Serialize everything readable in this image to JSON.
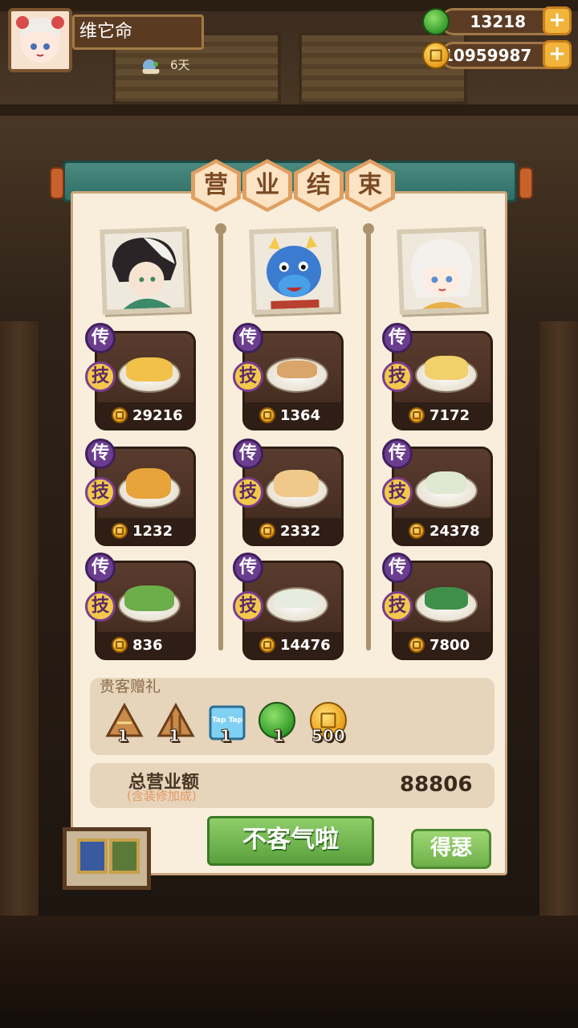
{
  "player": {
    "name": "维它命",
    "days": "6天"
  },
  "currency": {
    "jade": "13218",
    "gold": "10959987"
  },
  "panel": {
    "title_chars": [
      "营",
      "业",
      "结",
      "束"
    ]
  },
  "badges": {
    "chuan": "传",
    "ji": "技"
  },
  "columns": [
    {
      "dishes": [
        {
          "value": "29216"
        },
        {
          "value": "1232"
        },
        {
          "value": "836"
        }
      ]
    },
    {
      "dishes": [
        {
          "value": "1364"
        },
        {
          "value": "2332"
        },
        {
          "value": "14476"
        }
      ]
    },
    {
      "dishes": [
        {
          "value": "7172"
        },
        {
          "value": "24378"
        },
        {
          "value": "7800"
        }
      ]
    }
  ],
  "gifts": {
    "title": "贵客赠礼",
    "items": [
      {
        "icon": "rice-dumpling-icon",
        "count": "1"
      },
      {
        "icon": "rice-dumpling-stripe-icon",
        "count": "1"
      },
      {
        "icon": "taptap-box-icon",
        "count": "1",
        "text": "Tap Tap"
      },
      {
        "icon": "jade-icon",
        "count": "1"
      },
      {
        "icon": "gold-coin-icon",
        "count": "500"
      }
    ]
  },
  "total": {
    "label": "总营业额",
    "sublabel": "(含装修加成)",
    "value": "88806"
  },
  "buttons": {
    "confirm": "不客气啦",
    "share": "得瑟"
  },
  "colors": {
    "jade": "#3aa02e",
    "gold": "#e9a21d",
    "badge": "#6b3d8e",
    "button_green": "#6bb04a"
  }
}
